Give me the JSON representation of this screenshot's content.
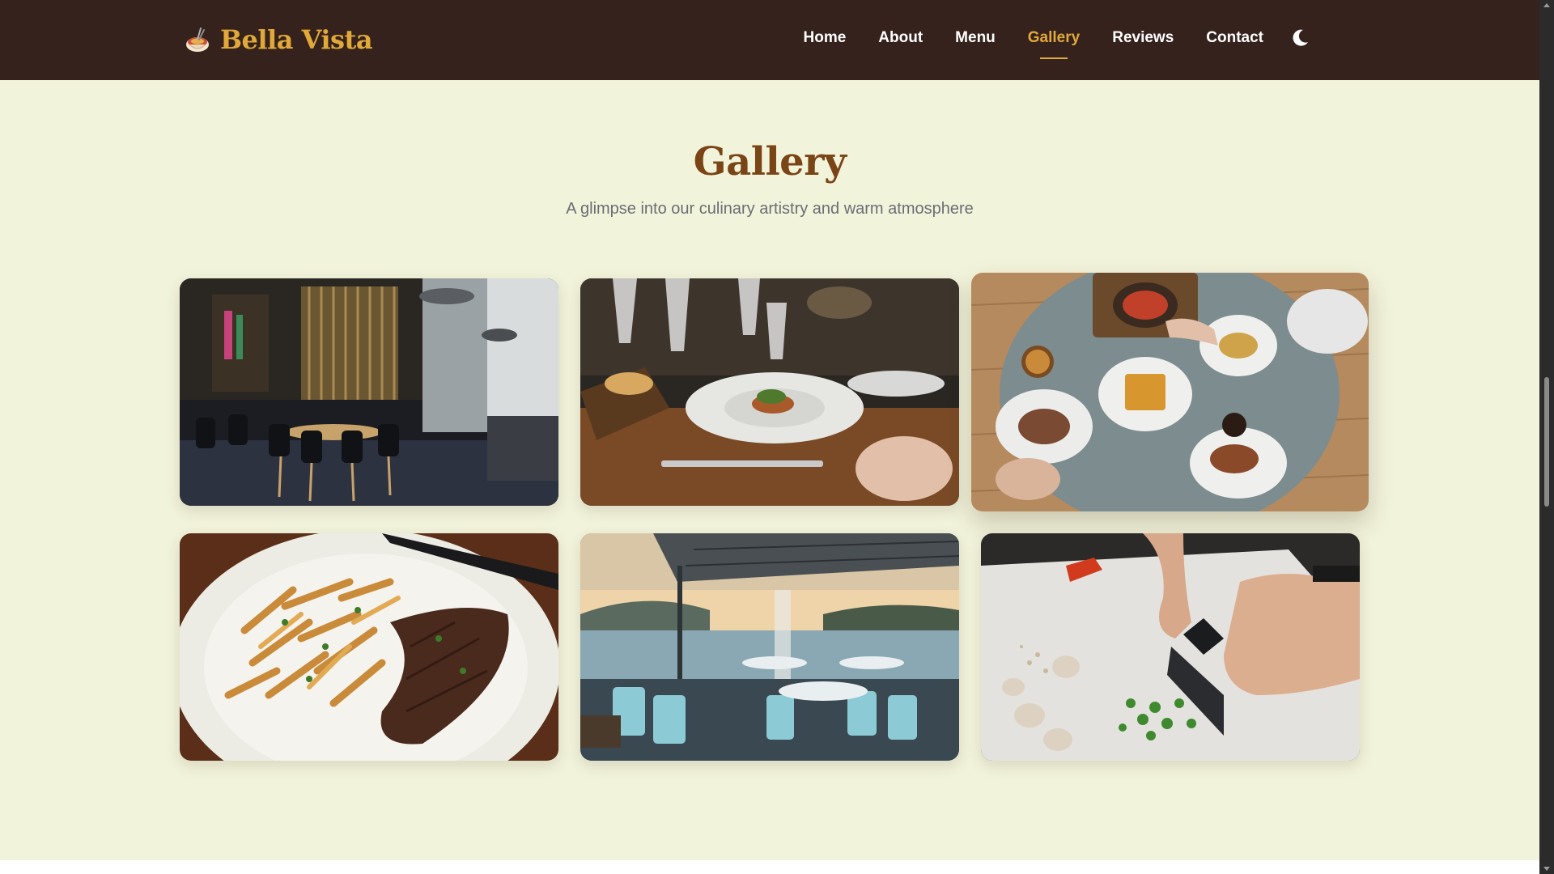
{
  "site": {
    "brand": "Bella Vista",
    "logo_icon": "pasta-bowl-icon",
    "brand_color": "#e0a93a",
    "header_bg": "#35221c"
  },
  "nav": {
    "items": [
      {
        "label": "Home",
        "active": false
      },
      {
        "label": "About",
        "active": false
      },
      {
        "label": "Menu",
        "active": false
      },
      {
        "label": "Gallery",
        "active": true
      },
      {
        "label": "Reviews",
        "active": false
      },
      {
        "label": "Contact",
        "active": false
      }
    ],
    "theme_toggle_icon": "moon-icon"
  },
  "gallery": {
    "title": "Gallery",
    "subtitle": "A glimpse into our culinary artistry and warm atmosphere",
    "images": [
      {
        "subject": "dark restaurant interior with wooden chairs and pendant lamps",
        "icon": "restaurant-interior-image"
      },
      {
        "subject": "plated dish on a set dinner table with wine glasses",
        "icon": "fine-dining-table-image"
      },
      {
        "subject": "top-down view of brunch plates with waffles and coffee",
        "icon": "brunch-overhead-image",
        "hovered": true
      },
      {
        "subject": "grilled steak with french fries on a white plate",
        "icon": "steak-frites-image"
      },
      {
        "subject": "waterfront terrace dining with awning and lake view",
        "icon": "terrace-lake-view-image"
      },
      {
        "subject": "chef chopping green vegetables on a cutting board",
        "icon": "chef-chopping-image"
      }
    ]
  }
}
